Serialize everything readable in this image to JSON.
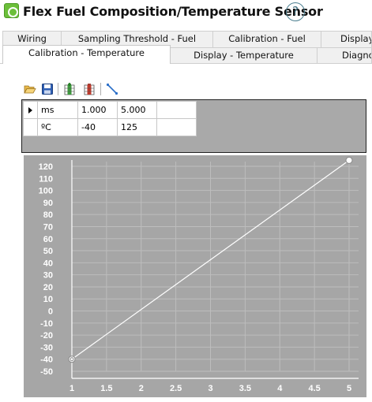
{
  "window": {
    "title": "Flex Fuel Composition/Temperature Sensor",
    "help_label": "?"
  },
  "tabs_row1": [
    {
      "label": "Wiring"
    },
    {
      "label": "Sampling Threshold - Fuel"
    },
    {
      "label": "Calibration - Fuel"
    },
    {
      "label": "Display"
    }
  ],
  "tabs_row2": [
    {
      "label": "Calibration - Temperature",
      "active": true
    },
    {
      "label": "Display - Temperature"
    },
    {
      "label": "Diagno"
    }
  ],
  "toolbar": {
    "icons": [
      "open-folder-icon",
      "save-icon",
      "add-column-icon",
      "delete-column-icon",
      "graph-line-icon"
    ]
  },
  "grid": {
    "rows": [
      {
        "header": "ms",
        "values": [
          "1.000",
          "5.000"
        ]
      },
      {
        "header": "ºC",
        "values": [
          "-40",
          "125"
        ]
      }
    ]
  },
  "chart_data": {
    "type": "line",
    "x": [
      1,
      5
    ],
    "y": [
      -40,
      125
    ],
    "xlim": [
      1,
      5
    ],
    "ylim": [
      -50,
      120
    ],
    "xticks": [
      "1",
      "1.5",
      "2",
      "2.5",
      "3",
      "3.5",
      "4",
      "4.5",
      "5"
    ],
    "yticks": [
      "120",
      "110",
      "100",
      "90",
      "80",
      "70",
      "60",
      "50",
      "40",
      "30",
      "20",
      "10",
      "0",
      "-10",
      "-20",
      "-30",
      "-40",
      "-50"
    ],
    "grid": true,
    "colors": {
      "background": "#a6a6a6",
      "line": "#ffffff",
      "grid": "#bdbdbd",
      "text": "#ffffff"
    }
  }
}
